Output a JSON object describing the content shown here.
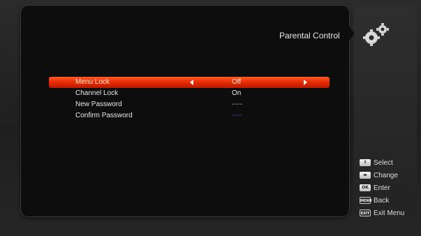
{
  "header": {
    "title": "Parental Control"
  },
  "menu": {
    "items": [
      {
        "label": "Menu Lock",
        "value": "Off",
        "selected": true
      },
      {
        "label": "Channel Lock",
        "value": "On",
        "selected": false
      },
      {
        "label": "New Password",
        "value": "----",
        "selected": false
      },
      {
        "label": "Confirm Password",
        "value": "----",
        "selected": false
      }
    ]
  },
  "help": {
    "items": [
      {
        "key": "⇕",
        "label": "Select",
        "icon": "updown-key-icon"
      },
      {
        "key": "◂▸",
        "label": "Change",
        "icon": "leftright-key-icon"
      },
      {
        "key": "OK",
        "label": "Enter",
        "icon": "ok-key-icon"
      },
      {
        "key": "MENU",
        "label": "Back",
        "icon": "menu-key-icon"
      },
      {
        "key": "EXIT",
        "label": "Exit Menu",
        "icon": "exit-key-icon"
      }
    ]
  },
  "colors": {
    "selected_row": "#e52a00",
    "placeholder_blue": "#3b5fd0"
  }
}
